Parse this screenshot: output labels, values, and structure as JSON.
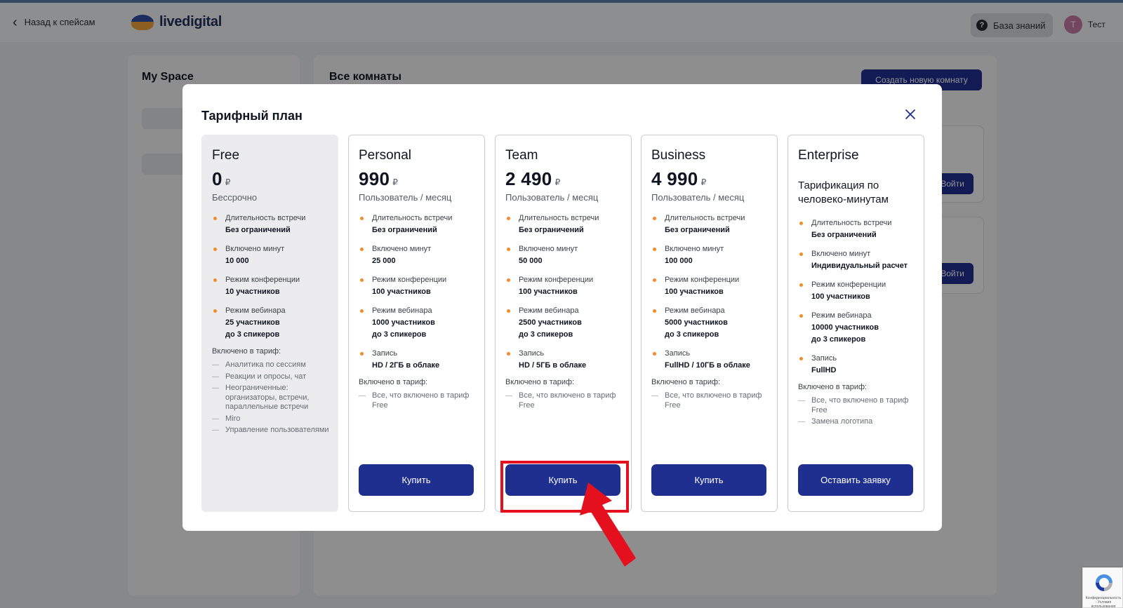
{
  "header": {
    "back_label": "Назад к спейсам",
    "logo_text": "livedigital",
    "knowledge_base": "База знаний",
    "user_initial": "Т",
    "user_name": "Тест"
  },
  "sidebar": {
    "title": "My Space"
  },
  "main": {
    "title": "Все комнаты",
    "create_room_button": "Создать новую комнату",
    "join_button_1": "Войти",
    "join_button_2": "Войти"
  },
  "modal": {
    "title": "Тарифный план",
    "plans": [
      {
        "name": "Free",
        "price": "0",
        "currency": "₽",
        "period": "Бессрочно",
        "features": [
          {
            "label": "Длительность встречи",
            "value": "Без ограничений"
          },
          {
            "label": "Включено минут",
            "value": "10 000"
          },
          {
            "label": "Режим конференции",
            "value": "10 участников"
          },
          {
            "label": "Режим вебинара",
            "value": "25 участников",
            "value2": "до 3 спикеров"
          }
        ],
        "included_title": "Включено в тариф:",
        "included": [
          "Аналитика по сессиям",
          "Реакции и опросы, чат",
          "Неограниченные: организаторы, встречи, параллельные встречи",
          "Miro",
          "Управление пользователями"
        ]
      },
      {
        "name": "Personal",
        "price": "990",
        "currency": "₽",
        "period": "Пользователь / месяц",
        "features": [
          {
            "label": "Длительность встречи",
            "value": "Без ограничений"
          },
          {
            "label": "Включено минут",
            "value": "25 000"
          },
          {
            "label": "Режим конференции",
            "value": "100 участников"
          },
          {
            "label": "Режим вебинара",
            "value": "1000 участников",
            "value2": "до 3 спикеров"
          },
          {
            "label": "Запись",
            "value": "HD / 2ГБ в облаке"
          }
        ],
        "included_title": "Включено в тариф:",
        "included": [
          "Все, что включено в тариф Free"
        ],
        "button": "Купить"
      },
      {
        "name": "Team",
        "price": "2 490",
        "currency": "₽",
        "period": "Пользователь / месяц",
        "features": [
          {
            "label": "Длительность встречи",
            "value": "Без ограничений"
          },
          {
            "label": "Включено минут",
            "value": "50 000"
          },
          {
            "label": "Режим конференции",
            "value": "100 участников"
          },
          {
            "label": "Режим вебинара",
            "value": "2500 участников",
            "value2": "до 3 спикеров"
          },
          {
            "label": "Запись",
            "value": "HD / 5ГБ в облаке"
          }
        ],
        "included_title": "Включено в тариф:",
        "included": [
          "Все, что включено в тариф Free"
        ],
        "button": "Купить"
      },
      {
        "name": "Business",
        "price": "4 990",
        "currency": "₽",
        "period": "Пользователь / месяц",
        "features": [
          {
            "label": "Длительность встречи",
            "value": "Без ограничений"
          },
          {
            "label": "Включено минут",
            "value": "100 000"
          },
          {
            "label": "Режим конференции",
            "value": "100 участников"
          },
          {
            "label": "Режим вебинара",
            "value": "5000 участников",
            "value2": "до 3 спикеров"
          },
          {
            "label": "Запись",
            "value": "FullHD / 10ГБ в облаке"
          }
        ],
        "included_title": "Включено в тариф:",
        "included": [
          "Все, что включено в тариф Free"
        ],
        "button": "Купить"
      },
      {
        "name": "Enterprise",
        "subtitle": "Тарификация по человеко-минутам",
        "features": [
          {
            "label": "Длительность встречи",
            "value": "Без ограничений"
          },
          {
            "label": "Включено минут",
            "value": "Индивидуальный расчет"
          },
          {
            "label": "Режим конференции",
            "value": "100 участников"
          },
          {
            "label": "Режим вебинара",
            "value": "10000 участников",
            "value2": "до 3 спикеров"
          },
          {
            "label": "Запись",
            "value": "FullHD"
          }
        ],
        "included_title": "Включено в тариф:",
        "included": [
          "Все, что включено в тариф Free",
          "Замена логотипа"
        ],
        "button": "Оставить заявку"
      }
    ]
  },
  "recaptcha": {
    "text": "Конфиденциальность - Условия использования"
  },
  "colors": {
    "primary": "#1f2f8f",
    "bullet": "#f28c28",
    "highlight": "#e5101e"
  }
}
